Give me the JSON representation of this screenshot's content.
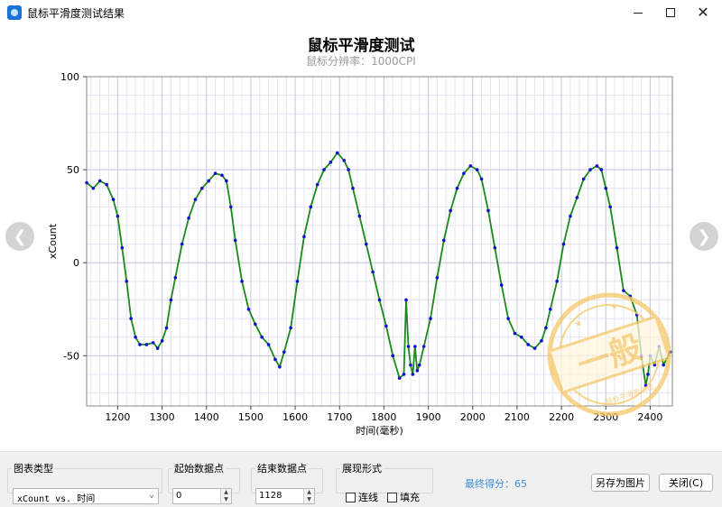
{
  "window": {
    "title": "鼠标平滑度测试结果",
    "app_icon": "app-icon",
    "controls": [
      "minimize-icon",
      "maximize-icon",
      "close-icon"
    ]
  },
  "chart": {
    "title": "鼠标平滑度测试",
    "subtitle": "鼠标分辨率：1000CPI"
  },
  "chart_data": {
    "type": "line",
    "xlabel": "时间(毫秒)",
    "ylabel": "xCount",
    "xlim": [
      1130,
      2450
    ],
    "ylim": [
      -77,
      100
    ],
    "xticks": [
      1200,
      1300,
      1400,
      1500,
      1600,
      1700,
      1800,
      1900,
      2000,
      2100,
      2200,
      2300,
      2400
    ],
    "yticks": [
      100,
      50,
      0,
      -50
    ],
    "grid": true,
    "series": [
      {
        "color": "#1a8a1a",
        "style": "line+points",
        "point_color": "#1010d0",
        "x": [
          1130,
          1145,
          1160,
          1175,
          1190,
          1200,
          1210,
          1220,
          1230,
          1240,
          1250,
          1265,
          1280,
          1290,
          1300,
          1310,
          1320,
          1330,
          1345,
          1360,
          1375,
          1390,
          1405,
          1420,
          1435,
          1445,
          1455,
          1465,
          1480,
          1495,
          1510,
          1525,
          1540,
          1555,
          1565,
          1575,
          1590,
          1605,
          1620,
          1635,
          1650,
          1665,
          1680,
          1695,
          1710,
          1720,
          1730,
          1745,
          1760,
          1775,
          1790,
          1805,
          1820,
          1835,
          1845,
          1850,
          1855,
          1860,
          1865,
          1870,
          1875,
          1880,
          1890,
          1905,
          1920,
          1935,
          1950,
          1965,
          1980,
          1995,
          2010,
          2020,
          2035,
          2050,
          2065,
          2080,
          2095,
          2110,
          2125,
          2140,
          2155,
          2165,
          2175,
          2190,
          2205,
          2220,
          2235,
          2250,
          2265,
          2280,
          2290,
          2300,
          2310,
          2325,
          2340,
          2355,
          2370,
          2380,
          2390,
          2395,
          2400,
          2410,
          2420,
          2430,
          2445
        ],
        "y": [
          43,
          40,
          44,
          42,
          34,
          25,
          8,
          -10,
          -30,
          -40,
          -44,
          -44,
          -43,
          -46,
          -42,
          -35,
          -20,
          -8,
          10,
          24,
          34,
          40,
          44,
          48,
          47,
          44,
          30,
          12,
          -10,
          -25,
          -33,
          -40,
          -44,
          -52,
          -56,
          -48,
          -35,
          -10,
          14,
          30,
          42,
          50,
          54,
          59,
          55,
          50,
          40,
          25,
          10,
          -5,
          -20,
          -34,
          -50,
          -62,
          -60,
          -20,
          -45,
          -55,
          -60,
          -45,
          -58,
          -55,
          -45,
          -30,
          -8,
          12,
          28,
          40,
          48,
          52,
          50,
          45,
          28,
          8,
          -12,
          -30,
          -38,
          -40,
          -44,
          -46,
          -42,
          -35,
          -25,
          -10,
          10,
          25,
          35,
          45,
          50,
          52,
          50,
          40,
          30,
          8,
          -15,
          -18,
          -28,
          -50,
          -66,
          -60,
          -50,
          -55,
          -45,
          -55,
          -48
        ]
      }
    ]
  },
  "watermark_stamp": {
    "text": "一般",
    "small_text": "鼠标平滑度测试",
    "color": "#f5c766"
  },
  "panel": {
    "chart_type_label": "图表类型",
    "chart_type_value": "xCount vs. 时间",
    "start_label": "起始数据点",
    "start_value": "0",
    "end_label": "结束数据点",
    "end_value": "1128",
    "style_label": "展现形式",
    "line_label": "连线",
    "fill_label": "填充",
    "score_text": "最终得分：65",
    "save_button": "另存为图片",
    "close_button": "关闭(C)"
  }
}
